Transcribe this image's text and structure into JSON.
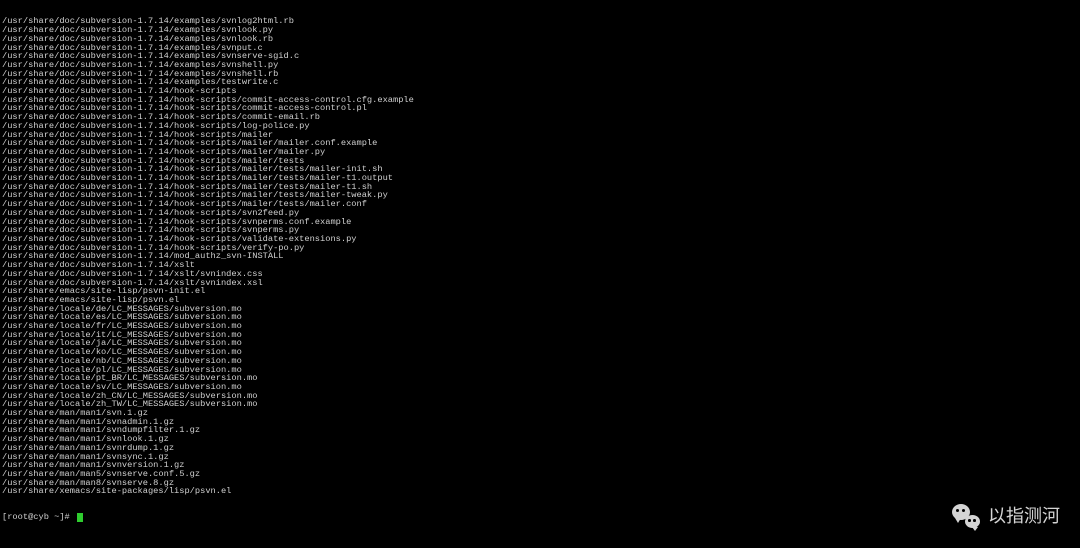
{
  "terminal": {
    "prompt": "[root@cyb ~]# ",
    "lines": [
      "/usr/share/doc/subversion-1.7.14/examples/svnlog2html.rb",
      "/usr/share/doc/subversion-1.7.14/examples/svnlook.py",
      "/usr/share/doc/subversion-1.7.14/examples/svnlook.rb",
      "/usr/share/doc/subversion-1.7.14/examples/svnput.c",
      "/usr/share/doc/subversion-1.7.14/examples/svnserve-sgid.c",
      "/usr/share/doc/subversion-1.7.14/examples/svnshell.py",
      "/usr/share/doc/subversion-1.7.14/examples/svnshell.rb",
      "/usr/share/doc/subversion-1.7.14/examples/testwrite.c",
      "/usr/share/doc/subversion-1.7.14/hook-scripts",
      "/usr/share/doc/subversion-1.7.14/hook-scripts/commit-access-control.cfg.example",
      "/usr/share/doc/subversion-1.7.14/hook-scripts/commit-access-control.pl",
      "/usr/share/doc/subversion-1.7.14/hook-scripts/commit-email.rb",
      "/usr/share/doc/subversion-1.7.14/hook-scripts/log-police.py",
      "/usr/share/doc/subversion-1.7.14/hook-scripts/mailer",
      "/usr/share/doc/subversion-1.7.14/hook-scripts/mailer/mailer.conf.example",
      "/usr/share/doc/subversion-1.7.14/hook-scripts/mailer/mailer.py",
      "/usr/share/doc/subversion-1.7.14/hook-scripts/mailer/tests",
      "/usr/share/doc/subversion-1.7.14/hook-scripts/mailer/tests/mailer-init.sh",
      "/usr/share/doc/subversion-1.7.14/hook-scripts/mailer/tests/mailer-t1.output",
      "/usr/share/doc/subversion-1.7.14/hook-scripts/mailer/tests/mailer-t1.sh",
      "/usr/share/doc/subversion-1.7.14/hook-scripts/mailer/tests/mailer-tweak.py",
      "/usr/share/doc/subversion-1.7.14/hook-scripts/mailer/tests/mailer.conf",
      "/usr/share/doc/subversion-1.7.14/hook-scripts/svn2feed.py",
      "/usr/share/doc/subversion-1.7.14/hook-scripts/svnperms.conf.example",
      "/usr/share/doc/subversion-1.7.14/hook-scripts/svnperms.py",
      "/usr/share/doc/subversion-1.7.14/hook-scripts/validate-extensions.py",
      "/usr/share/doc/subversion-1.7.14/hook-scripts/verify-po.py",
      "/usr/share/doc/subversion-1.7.14/mod_authz_svn-INSTALL",
      "/usr/share/doc/subversion-1.7.14/xslt",
      "/usr/share/doc/subversion-1.7.14/xslt/svnindex.css",
      "/usr/share/doc/subversion-1.7.14/xslt/svnindex.xsl",
      "/usr/share/emacs/site-lisp/psvn-init.el",
      "/usr/share/emacs/site-lisp/psvn.el",
      "/usr/share/locale/de/LC_MESSAGES/subversion.mo",
      "/usr/share/locale/es/LC_MESSAGES/subversion.mo",
      "/usr/share/locale/fr/LC_MESSAGES/subversion.mo",
      "/usr/share/locale/it/LC_MESSAGES/subversion.mo",
      "/usr/share/locale/ja/LC_MESSAGES/subversion.mo",
      "/usr/share/locale/ko/LC_MESSAGES/subversion.mo",
      "/usr/share/locale/nb/LC_MESSAGES/subversion.mo",
      "/usr/share/locale/pl/LC_MESSAGES/subversion.mo",
      "/usr/share/locale/pt_BR/LC_MESSAGES/subversion.mo",
      "/usr/share/locale/sv/LC_MESSAGES/subversion.mo",
      "/usr/share/locale/zh_CN/LC_MESSAGES/subversion.mo",
      "/usr/share/locale/zh_TW/LC_MESSAGES/subversion.mo",
      "/usr/share/man/man1/svn.1.gz",
      "/usr/share/man/man1/svnadmin.1.gz",
      "/usr/share/man/man1/svndumpfilter.1.gz",
      "/usr/share/man/man1/svnlook.1.gz",
      "/usr/share/man/man1/svnrdump.1.gz",
      "/usr/share/man/man1/svnsync.1.gz",
      "/usr/share/man/man1/svnversion.1.gz",
      "/usr/share/man/man5/svnserve.conf.5.gz",
      "/usr/share/man/man8/svnserve.8.gz",
      "/usr/share/xemacs/site-packages/lisp/psvn.el"
    ]
  },
  "watermark": {
    "text": "以指测河"
  }
}
